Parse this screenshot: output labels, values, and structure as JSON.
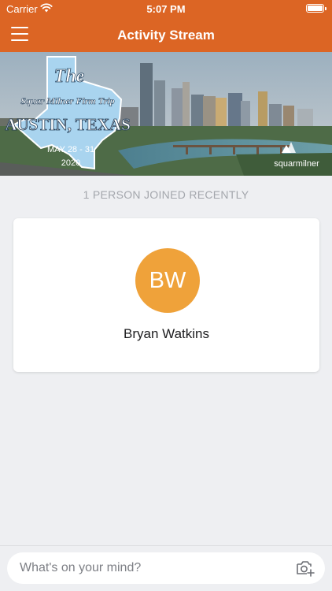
{
  "status_bar": {
    "carrier": "Carrier",
    "time": "5:07 PM"
  },
  "nav": {
    "title": "Activity Stream",
    "menu_icon": "hamburger-icon"
  },
  "banner": {
    "line1": "The",
    "line2": "Squar Milner Firm Trip",
    "line3": "AUSTIN, TEXAS",
    "dates": "MAY 28 - 31",
    "year": "2020",
    "brand": "squarmilner"
  },
  "feed": {
    "joined_label": "1 PERSON JOINED RECENTLY",
    "member": {
      "initials": "BW",
      "name": "Bryan Watkins"
    }
  },
  "composer": {
    "placeholder": "What's on your mind?",
    "camera_icon": "camera-plus-icon"
  },
  "colors": {
    "header": "#dc6524",
    "avatar": "#efa23a",
    "background": "#eeeff2"
  }
}
